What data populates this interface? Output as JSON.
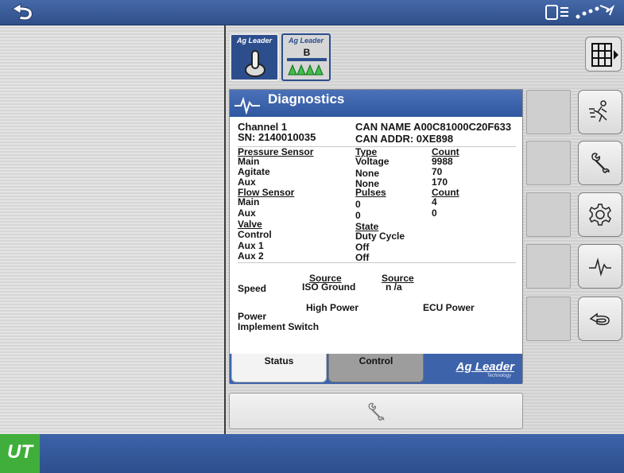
{
  "panel": {
    "title": "Diagnostics",
    "channel": "Channel 1",
    "serial": "SN: 2140010035",
    "can_name": "CAN NAME A00C81000C20F633",
    "can_addr": "CAN ADDR:  0XE898"
  },
  "pressure": {
    "header": "Pressure Sensor",
    "type_header": "Type",
    "count_header": "Count",
    "rows": [
      {
        "label": "Main",
        "type": "Voltage",
        "count": "9988"
      },
      {
        "label": "Agitate",
        "type": "None",
        "count": "70"
      },
      {
        "label": "Aux",
        "type": "None",
        "count": "170"
      }
    ]
  },
  "flow": {
    "header": "Flow Sensor",
    "pulses_header": "Pulses",
    "count_header": "Count",
    "rows": [
      {
        "label": "Main",
        "pulses": "0",
        "count": "4"
      },
      {
        "label": "Aux",
        "pulses": "0",
        "count": "0"
      }
    ]
  },
  "valve": {
    "header": "Valve",
    "state_header": "State",
    "rows": [
      {
        "label": "Control",
        "state": "Duty Cycle"
      },
      {
        "label": "Aux 1",
        "state": "Off"
      },
      {
        "label": "Aux 2",
        "state": "Off"
      }
    ]
  },
  "speed": {
    "source_header_1": "Source",
    "source_header_2": "Source",
    "label": "Speed",
    "source_1": "ISO Ground",
    "source_2": "n /a"
  },
  "power": {
    "high_power": "High Power",
    "ecu_power": "ECU Power",
    "power_label": "Power",
    "implement_switch": "Implement Switch"
  },
  "tabs": {
    "status": "Status",
    "control": "Control"
  },
  "branding": {
    "module_brand": "Ag Leader",
    "module_b_label": "B",
    "ag_logo": "Ag Leader",
    "ag_logo_sub": "Technology",
    "ut_logo": "UT"
  },
  "icons": [
    "back-arrow-icon",
    "display-status-icon",
    "signal-icon",
    "grid-menu-icon",
    "running-person-icon",
    "wrench-icon",
    "gear-icon",
    "pulse-icon",
    "return-icon"
  ],
  "colors": {
    "header_blue": "#2f57a0",
    "ut_green": "#3fae3a"
  }
}
